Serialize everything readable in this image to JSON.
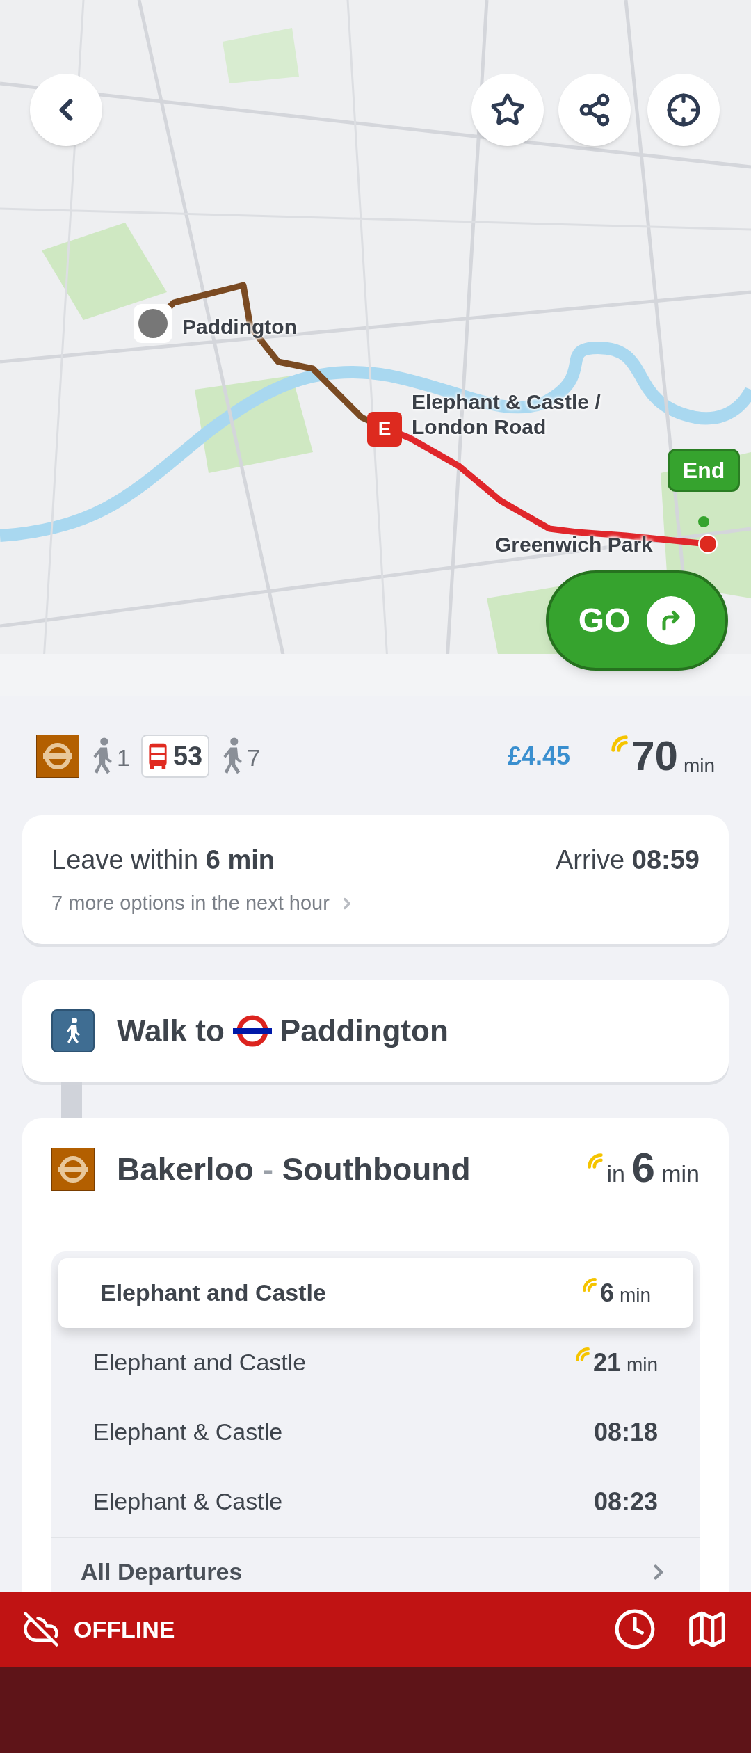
{
  "map": {
    "route_labels": [
      {
        "kind": "start",
        "text": "Paddington"
      },
      {
        "kind": "alight",
        "text": "Elephant & Castle / London Road"
      },
      {
        "kind": "end",
        "text": "Greenwich Park"
      }
    ],
    "alight_marker": "E",
    "end_pin": "End",
    "go_button": "GO"
  },
  "summary": {
    "legs": [
      {
        "kind": "tube"
      },
      {
        "kind": "walk",
        "text": "1"
      },
      {
        "kind": "bus",
        "text": "53"
      },
      {
        "kind": "walk",
        "text": "7"
      }
    ],
    "price": "£4.45",
    "duration": "70",
    "duration_unit": "min"
  },
  "leave_card": {
    "leave_label": "Leave within",
    "leave_value": "6 min",
    "arrive_label": "Arrive",
    "arrive_value": "08:59",
    "more_options": "7 more options in the next hour"
  },
  "walk_step": {
    "prefix": "Walk to",
    "station": "Paddington"
  },
  "line_step": {
    "line": "Bakerloo",
    "separator": "-",
    "direction": "Southbound",
    "in": "in",
    "minutes": "6",
    "unit": "min",
    "departures": [
      {
        "destination": "Elephant and Castle",
        "kind": "live",
        "time": "6",
        "unit": "min",
        "selected": true
      },
      {
        "destination": "Elephant and Castle",
        "kind": "live",
        "time": "21",
        "unit": "min",
        "selected": false
      },
      {
        "destination": "Elephant & Castle",
        "kind": "scheduled",
        "time": "08:18",
        "selected": false
      },
      {
        "destination": "Elephant & Castle",
        "kind": "scheduled",
        "time": "08:23",
        "selected": false
      }
    ],
    "all_departures": "All Departures"
  },
  "offline_bar": {
    "label": "OFFLINE"
  }
}
